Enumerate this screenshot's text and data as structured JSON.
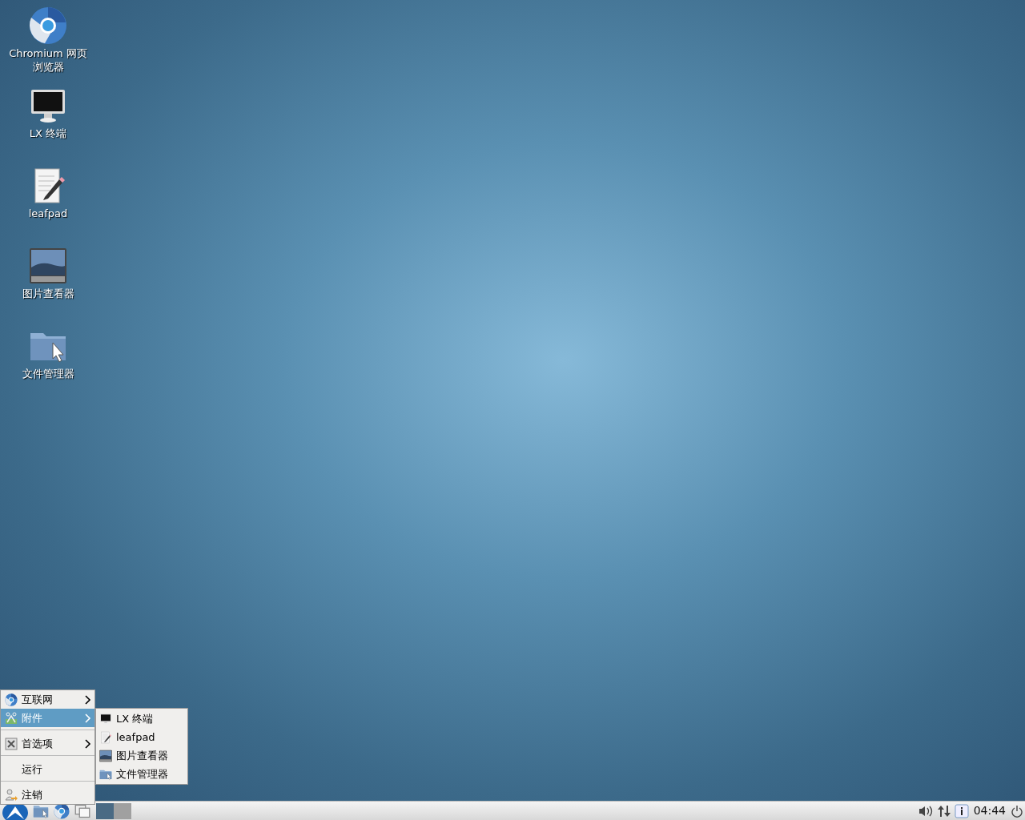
{
  "desktop_icons": [
    {
      "kind": "browser",
      "label": "Chromium 网页浏览器"
    },
    {
      "kind": "terminal",
      "label": "LX 终端"
    },
    {
      "kind": "editor",
      "label": "leafpad"
    },
    {
      "kind": "image",
      "label": "图片查看器"
    },
    {
      "kind": "folder",
      "label": "文件管理器"
    }
  ],
  "menu": {
    "items": [
      {
        "kind": "submenu",
        "label": "互联网",
        "selected": false
      },
      {
        "kind": "submenu",
        "label": "附件",
        "selected": true,
        "children": [
          {
            "label": "LX 终端"
          },
          {
            "label": "leafpad"
          },
          {
            "label": "图片查看器"
          },
          {
            "label": "文件管理器"
          }
        ]
      },
      {
        "kind": "separator"
      },
      {
        "kind": "submenu",
        "label": "首选项",
        "selected": false
      },
      {
        "kind": "separator"
      },
      {
        "kind": "action",
        "label": "运行",
        "selected": false
      },
      {
        "kind": "separator"
      },
      {
        "kind": "action",
        "label": "注销",
        "selected": false
      }
    ]
  },
  "taskbar": {
    "pager": [
      {
        "selected": true
      },
      {
        "selected": false
      }
    ],
    "clock": "04:44"
  }
}
